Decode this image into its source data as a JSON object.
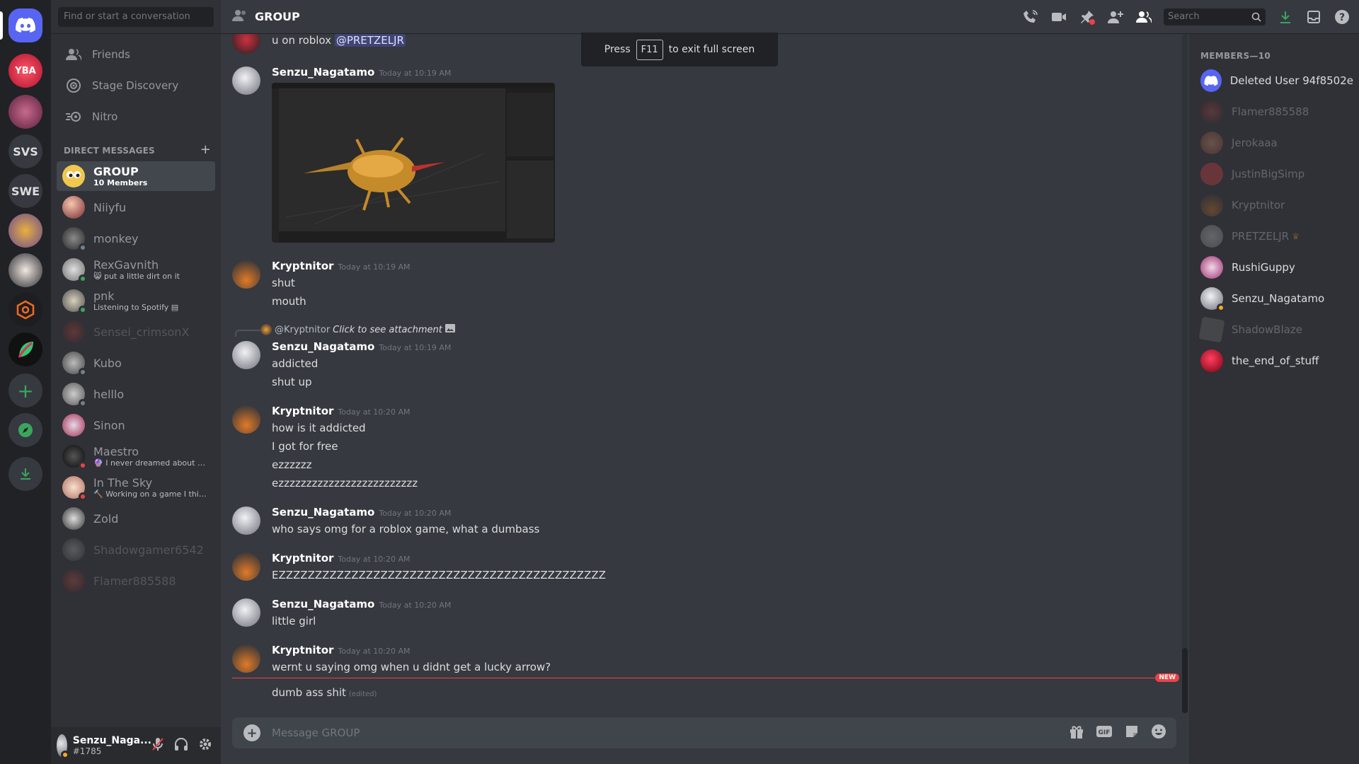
{
  "servers": [
    {
      "name": "home",
      "label": ""
    },
    {
      "name": "yba",
      "label": "YBA"
    },
    {
      "name": "server-2",
      "label": ""
    },
    {
      "name": "svs",
      "label": "SVS"
    },
    {
      "name": "swe",
      "label": "SWE"
    },
    {
      "name": "server-5",
      "label": ""
    },
    {
      "name": "server-6",
      "label": ""
    },
    {
      "name": "server-7",
      "label": ""
    },
    {
      "name": "server-8",
      "label": ""
    }
  ],
  "sidebar": {
    "search_placeholder": "Find or start a conversation",
    "nav": [
      {
        "label": "Friends",
        "icon": "friends-icon"
      },
      {
        "label": "Stage Discovery",
        "icon": "stage-icon"
      },
      {
        "label": "Nitro",
        "icon": "nitro-icon"
      }
    ],
    "dm_header": "DIRECT MESSAGES",
    "dms": [
      {
        "name": "GROUP",
        "sub": "10 Members",
        "active": true
      },
      {
        "name": "Niiyfu",
        "sub": ""
      },
      {
        "name": "monkey",
        "sub": ""
      },
      {
        "name": "RexGavnith",
        "sub": "put a little dirt on it"
      },
      {
        "name": "pnk",
        "sub": "Listening to Spotify"
      },
      {
        "name": "Sensei_crimsonX",
        "sub": "",
        "offline": true
      },
      {
        "name": "Kubo",
        "sub": ""
      },
      {
        "name": "helllo",
        "sub": ""
      },
      {
        "name": "Sinon",
        "sub": ""
      },
      {
        "name": "Maestro",
        "sub": "I never dreamed about su..."
      },
      {
        "name": "In The Sky",
        "sub": "Working on a game I think"
      },
      {
        "name": "Zold",
        "sub": ""
      },
      {
        "name": "Shadowgamer6542",
        "sub": "",
        "offline": true
      },
      {
        "name": "Flamer885588",
        "sub": "",
        "offline": true
      }
    ]
  },
  "user": {
    "name": "Senzu_Naga...",
    "tag": "#1785"
  },
  "header": {
    "title": "GROUP",
    "search_placeholder": "Search"
  },
  "toast": {
    "press": "Press",
    "key": "F11",
    "rest": "to exit full screen"
  },
  "messages": [
    {
      "text": "u on roblox",
      "mention": "@PRETZELJR"
    },
    {
      "author": "Senzu_Nagatamo",
      "time": "Today at 10:19 AM"
    },
    {
      "author": "Kryptnitor",
      "time": "Today at 10:19 AM",
      "lines": [
        "shut",
        "mouth"
      ]
    },
    {
      "reply_author": "@Kryptnitor",
      "reply_text": "Click to see attachment",
      "author": "Senzu_Nagatamo",
      "time": "Today at 10:19 AM",
      "lines": [
        "addicted",
        "shut up"
      ]
    },
    {
      "author": "Kryptnitor",
      "time": "Today at 10:20 AM",
      "lines": [
        "how is it addicted",
        "I got for free",
        "ezzzzzz",
        "ezzzzzzzzzzzzzzzzzzzzzzzzz"
      ]
    },
    {
      "author": "Senzu_Nagatamo",
      "time": "Today at 10:20 AM",
      "lines": [
        "who says omg for a roblox game, what a dumbass"
      ]
    },
    {
      "author": "Kryptnitor",
      "time": "Today at 10:20 AM",
      "lines": [
        "EZZZZZZZZZZZZZZZZZZZZZZZZZZZZZZZZZZZZZZZZZZZZZ"
      ]
    },
    {
      "author": "Senzu_Nagatamo",
      "time": "Today at 10:20 AM",
      "lines": [
        "little girl"
      ]
    },
    {
      "author": "Kryptnitor",
      "time": "Today at 10:20 AM",
      "lines": [
        "wernt u saying omg when u didnt get a lucky arrow?"
      ]
    },
    {
      "lines": [
        "dumb ass shit"
      ],
      "edited": "(edited)"
    }
  ],
  "new_badge": "NEW",
  "composer": {
    "placeholder": "Message GROUP"
  },
  "members": {
    "header": "MEMBERS—10",
    "list": [
      {
        "name": "Deleted User 94f8502e",
        "online": true
      },
      {
        "name": "Flamer885588",
        "online": false
      },
      {
        "name": "Jerokaaa",
        "online": false
      },
      {
        "name": "JustinBigSimp",
        "online": false
      },
      {
        "name": "Kryptnitor",
        "online": false
      },
      {
        "name": "PRETZELJR",
        "online": false,
        "owner": true
      },
      {
        "name": "RushiGuppy",
        "online": true
      },
      {
        "name": "Senzu_Nagatamo",
        "online": true
      },
      {
        "name": "ShadowBlaze",
        "online": false
      },
      {
        "name": "the_end_of_stuff",
        "online": true
      }
    ]
  },
  "colors": {
    "accent": "#5865f2",
    "online": "#3ba55d",
    "dnd": "#ed4245",
    "idle": "#faa81a",
    "new_line": "#ed4245"
  }
}
